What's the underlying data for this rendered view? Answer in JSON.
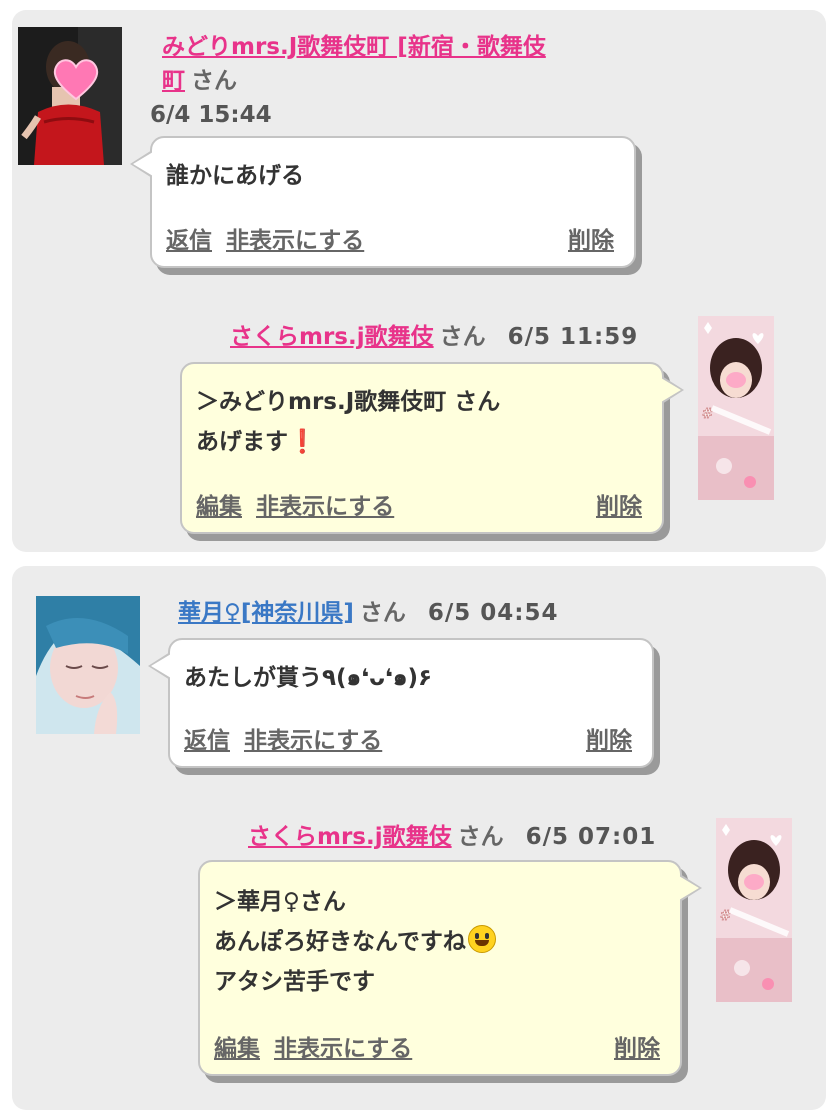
{
  "threads": [
    {
      "comment": {
        "author": "みどりmrs.J歌舞伎町 [新宿・歌舞伎町]",
        "author_line1": "みどりmrs.J歌舞伎町 [新宿・歌舞伎",
        "author_line2": "町",
        "suffix": "さん",
        "time": "6/4 15:44",
        "body": "誰かにあげる",
        "actions": {
          "reply": "返信",
          "hide": "非表示にする",
          "delete": "削除"
        }
      },
      "reply": {
        "author": "さくらmrs.j歌舞伎",
        "suffix": "さん",
        "time": "6/5 11:59",
        "body_line1": "＞みどりmrs.J歌舞伎町 さん",
        "body_line2": "あげます",
        "emoji": "❗",
        "actions": {
          "edit": "編集",
          "hide": "非表示にする",
          "delete": "削除"
        }
      }
    },
    {
      "comment": {
        "author": "華月♀[神奈川県]",
        "suffix": "さん",
        "time": "6/5 04:54",
        "body": "あたしが貰う٩(๑❛ᴗ❛๑)۶",
        "actions": {
          "reply": "返信",
          "hide": "非表示にする",
          "delete": "削除"
        }
      },
      "reply": {
        "author": "さくらmrs.j歌舞伎",
        "suffix": "さん",
        "time": "6/5 07:01",
        "body_line1": "＞華月♀さん",
        "body_line2": "あんぽろ好きなんですね",
        "body_line3": "アタシ苦手です",
        "actions": {
          "edit": "編集",
          "hide": "非表示にする",
          "delete": "削除"
        }
      }
    }
  ],
  "colors": {
    "username_pink": "#e8338a",
    "username_blue": "#3a78c5",
    "reply_bubble": "#ffffdd",
    "panel": "#ececec"
  },
  "icons": [
    "heart-sticker-icon",
    "smiley-emoji-icon",
    "exclamation-emoji-icon"
  ]
}
